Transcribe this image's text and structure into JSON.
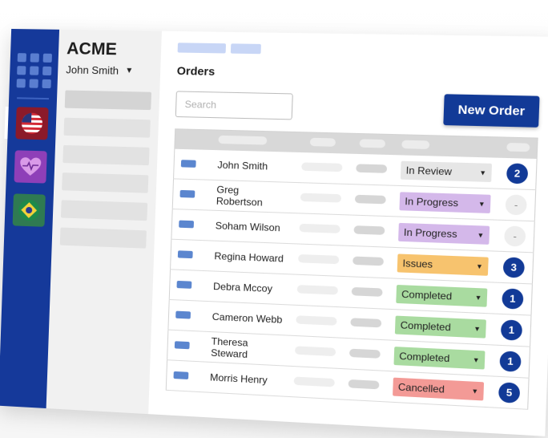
{
  "brand": "ACME",
  "user": {
    "name": "John Smith"
  },
  "page": {
    "title": "Orders"
  },
  "search": {
    "placeholder": "Search"
  },
  "actions": {
    "new_order_label": "New Order"
  },
  "rail": {
    "apps": [
      "flag-us-icon",
      "health-heart-icon",
      "flag-brazil-icon"
    ]
  },
  "orders": [
    {
      "name": "John Smith",
      "status": "In Review",
      "status_color": "#e6e6e6",
      "count": "2"
    },
    {
      "name": "Greg Robertson",
      "status": "In Progress",
      "status_color": "#d4b8ea",
      "count": "-"
    },
    {
      "name": "Soham Wilson",
      "status": "In Progress",
      "status_color": "#d4b8ea",
      "count": "-"
    },
    {
      "name": "Regina Howard",
      "status": "Issues",
      "status_color": "#f7c36e",
      "count": "3"
    },
    {
      "name": "Debra Mccoy",
      "status": "Completed",
      "status_color": "#a9dba0",
      "count": "1"
    },
    {
      "name": "Cameron Webb",
      "status": "Completed",
      "status_color": "#a9dba0",
      "count": "1"
    },
    {
      "name": "Theresa Steward",
      "status": "Completed",
      "status_color": "#a9dba0",
      "count": "1"
    },
    {
      "name": "Morris Henry",
      "status": "Cancelled",
      "status_color": "#f39a96",
      "count": "5"
    }
  ],
  "colors": {
    "primary": "#123a97",
    "rail": "#15399a"
  }
}
